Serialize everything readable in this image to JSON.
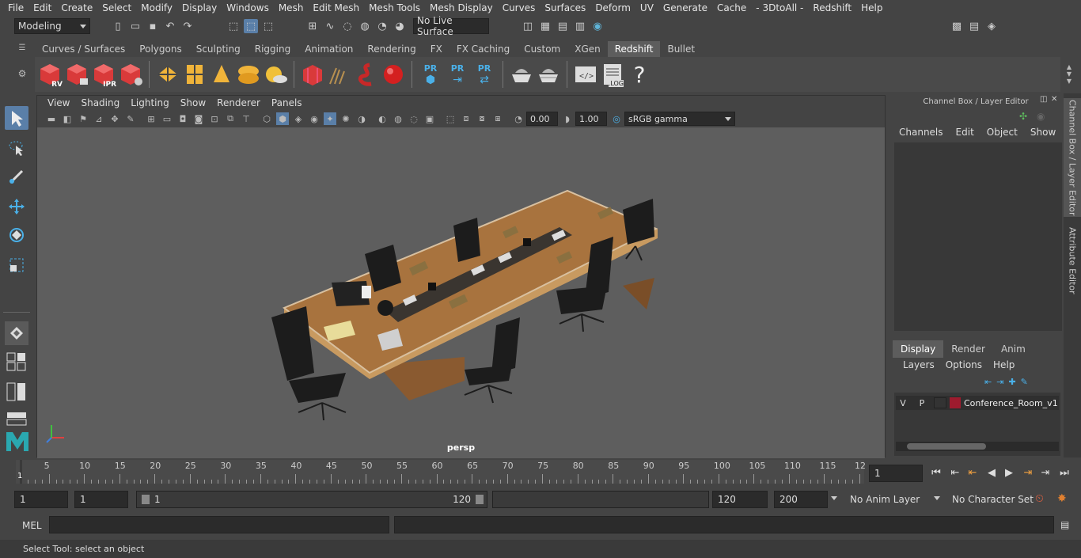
{
  "menubar": [
    "File",
    "Edit",
    "Create",
    "Select",
    "Modify",
    "Display",
    "Windows",
    "Mesh",
    "Edit Mesh",
    "Mesh Tools",
    "Mesh Display",
    "Curves",
    "Surfaces",
    "Deform",
    "UV",
    "Generate",
    "Cache",
    "- 3DtoAll -",
    "Redshift",
    "Help"
  ],
  "status": {
    "workspace": "Modeling",
    "live_surface": "No Live Surface"
  },
  "shelf_tabs": [
    {
      "label": "Curves / Surfaces",
      "active": false
    },
    {
      "label": "Polygons",
      "active": false
    },
    {
      "label": "Sculpting",
      "active": false
    },
    {
      "label": "Rigging",
      "active": false
    },
    {
      "label": "Animation",
      "active": false
    },
    {
      "label": "Rendering",
      "active": false
    },
    {
      "label": "FX",
      "active": false
    },
    {
      "label": "FX Caching",
      "active": false
    },
    {
      "label": "Custom",
      "active": false
    },
    {
      "label": "XGen",
      "active": false
    },
    {
      "label": "Redshift",
      "active": true
    },
    {
      "label": "Bullet",
      "active": false
    }
  ],
  "shelf_labels": {
    "rv": "RV",
    "ipr": "IPR",
    "pr": "PR",
    "log": ".LOG",
    "help": "?"
  },
  "viewport": {
    "menu": [
      "View",
      "Shading",
      "Lighting",
      "Show",
      "Renderer",
      "Panels"
    ],
    "exposure": "0.00",
    "gamma": "1.00",
    "colorspace": "sRGB gamma",
    "camera": "persp"
  },
  "channel_box": {
    "title": "Channel Box / Layer Editor",
    "menu": [
      "Channels",
      "Edit",
      "Object",
      "Show"
    ],
    "layer_tabs": [
      "Display",
      "Render",
      "Anim"
    ],
    "layer_menu": [
      "Layers",
      "Options",
      "Help"
    ],
    "layer": {
      "v": "V",
      "p": "P",
      "name": "Conference_Room_v1",
      "color": "#9e1b2e"
    }
  },
  "side_tabs": [
    "Channel Box / Layer Editor",
    "Attribute Editor"
  ],
  "timeline": {
    "ticks": [
      "5",
      "10",
      "15",
      "20",
      "25",
      "30",
      "35",
      "40",
      "45",
      "50",
      "55",
      "60",
      "65",
      "70",
      "75",
      "80",
      "85",
      "90",
      "95",
      "100",
      "105",
      "110",
      "115",
      "12"
    ],
    "current": "1",
    "current_field": "1"
  },
  "range": {
    "start": "1",
    "start2": "1",
    "slider_start": "1",
    "slider_end": "120",
    "end": "120",
    "end2": "200",
    "anim_layer": "No Anim Layer",
    "char_set": "No Character Set"
  },
  "cmd": {
    "lang": "MEL"
  },
  "help_line": "Select Tool: select an object"
}
